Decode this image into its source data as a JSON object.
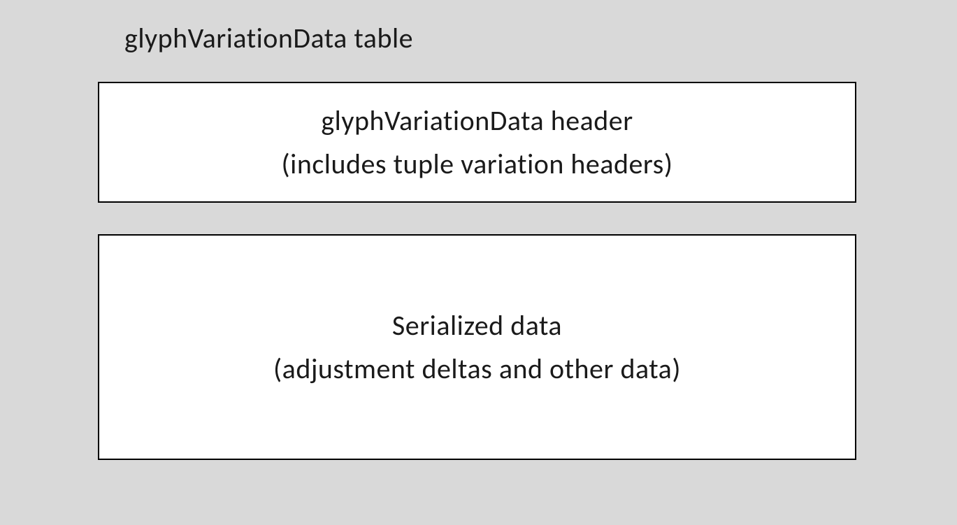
{
  "diagram": {
    "title": "glyphVariationData table",
    "box1": {
      "line1": "glyphVariationData header",
      "line2": "(includes tuple variation headers)"
    },
    "box2": {
      "line1": "Serialized data",
      "line2": "(adjustment deltas and other data)"
    }
  }
}
